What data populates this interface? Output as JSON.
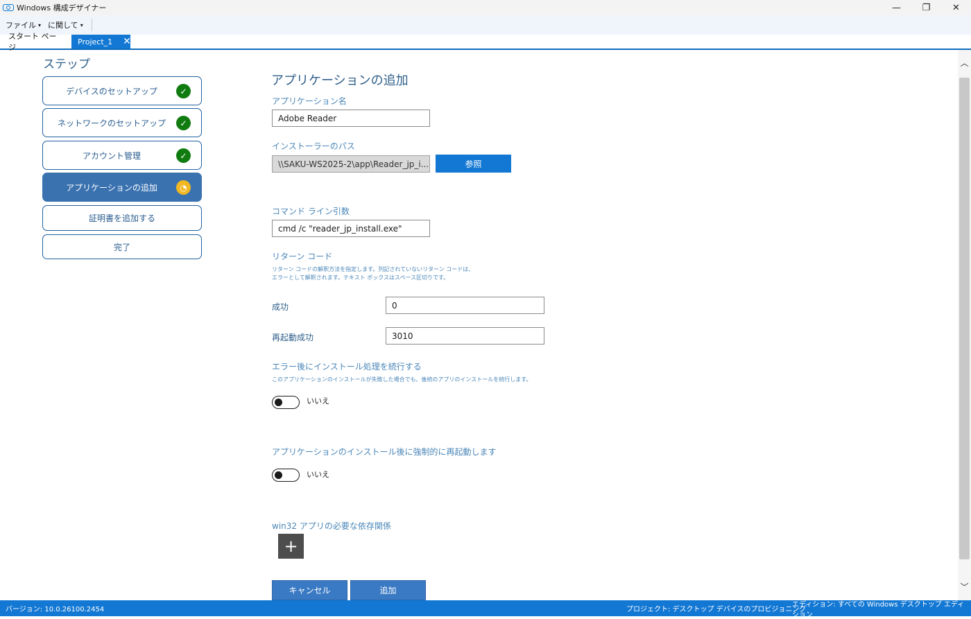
{
  "window": {
    "title": "Windows 構成デザイナー",
    "controls": {
      "minimize": "—",
      "restore": "❐",
      "close": "✕"
    }
  },
  "menu": {
    "items": [
      {
        "label": "ファイル"
      },
      {
        "label": "に関して"
      }
    ]
  },
  "tabs": [
    {
      "label": "スタート ページ"
    },
    {
      "label": "Project_1",
      "close": "✕"
    }
  ],
  "steps": {
    "title": "ステップ",
    "items": [
      {
        "label": "デバイスのセットアップ",
        "status": "done",
        "status_glyph": "✓"
      },
      {
        "label": "ネットワークのセットアップ",
        "status": "done",
        "status_glyph": "✓"
      },
      {
        "label": "アカウント管理",
        "status": "done",
        "status_glyph": "✓"
      },
      {
        "label": "アプリケーションの追加",
        "status": "in-progress",
        "status_glyph": "◔"
      },
      {
        "label": "証明書を追加する",
        "status": "none"
      },
      {
        "label": "完了",
        "status": "none"
      }
    ]
  },
  "form": {
    "title": "アプリケーションの追加",
    "app_name": {
      "label": "アプリケーション名",
      "value": "Adobe Reader"
    },
    "installer_path": {
      "label": "インストーラーのパス",
      "value": "\\\\SAKU-WS2025-2\\app\\Reader_jp_i...",
      "browse_label": "参照"
    },
    "command_line": {
      "label": "コマンド ライン引数",
      "value": "cmd /c \"reader_jp_install.exe\""
    },
    "return_code": {
      "label": "リターン コード",
      "desc_line1": "リターン コードの解釈方法を指定します。列記されていないリターン コードは、",
      "desc_line2": "エラーとして解釈されます。テキスト ボックスはスペース区切りです。",
      "success_label": "成功",
      "success_value": "0",
      "reboot_success_label": "再起動成功",
      "reboot_success_value": "3010"
    },
    "continue_on_error": {
      "label": "エラー後にインストール処理を続行する",
      "desc": "このアプリケーションのインストールが失敗した場合でも、後続のアプリのインストールを続行します。",
      "toggle_text": "いいえ",
      "on": false
    },
    "force_reboot": {
      "label": "アプリケーションのインストール後に強制的に再起動します",
      "toggle_text": "いいえ",
      "on": false
    },
    "dependencies": {
      "label": "win32 アプリの必要な依存関係",
      "add_glyph": "+"
    },
    "cancel_label": "キャンセル",
    "add_label": "追加"
  },
  "statusbar": {
    "version": "バージョン: 10.0.26100.2454",
    "project": "プロジェクト: デスクトップ デバイスのプロビジョニング",
    "edition": "エディション: すべての Windows デスクトップ エディション"
  },
  "colors": {
    "accent": "#1378d4",
    "step_done": "#107c10",
    "step_progress": "#f2b822",
    "step_active_bg": "#3a72b0"
  }
}
